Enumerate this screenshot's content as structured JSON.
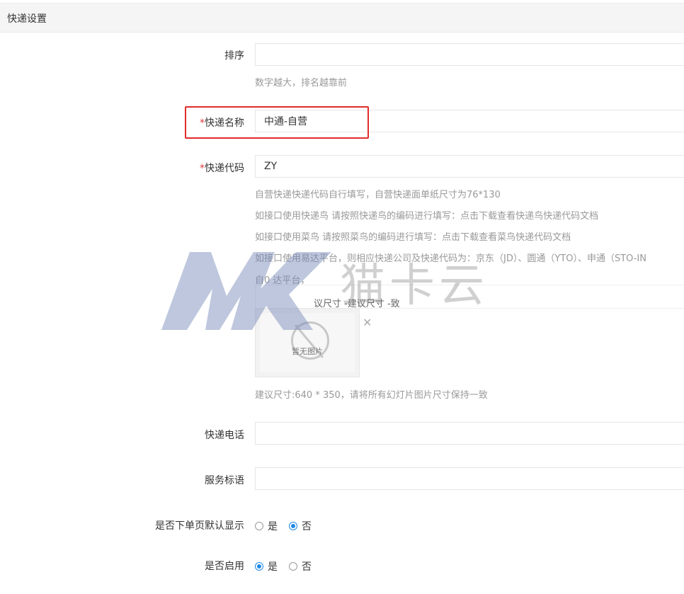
{
  "header": {
    "title": "快递设置"
  },
  "fields": {
    "sort": {
      "label": "排序",
      "value": "",
      "hint": "数字越大，排名越靠前"
    },
    "name": {
      "required_mark": "*",
      "label": "快递名称",
      "value": "中通-自营"
    },
    "code": {
      "required_mark": "*",
      "label": "快递代码",
      "value": "ZY",
      "hints": [
        "自营快递快递代码自行填写，自营快递面单纸尺寸为76*130",
        "如接口使用快递鸟 请按照快递鸟的编码进行填写：点击下载查看快递鸟快递代码文档",
        "如接口使用菜鸟 请按照菜鸟的编码进行填写：点击下载查看菜鸟快递代码文档",
        "如接口使用易达平台，则相应快递公司及快递代码为：京东（JD）、圆通（YTO）、申通（STO-IN",
        "自0 达平台，"
      ]
    },
    "image": {
      "partial_label": "议尺寸 -建议尺寸 -致",
      "placeholder_text": "暂无图片",
      "hint": "建议尺寸:640 * 350，请将所有幻灯片图片尺寸保持一致"
    },
    "phone": {
      "label": "快递电话",
      "value": ""
    },
    "slogan": {
      "label": "服务标语",
      "value": ""
    },
    "default_show": {
      "label": "是否下单页默认显示",
      "options": [
        "是",
        "否"
      ],
      "selected": "否"
    },
    "enabled": {
      "label": "是否启用",
      "options": [
        "是",
        "否"
      ],
      "selected": "是"
    }
  },
  "watermark": {
    "text": "猫卡云"
  },
  "colors": {
    "accent": "#1e88e5",
    "highlight": "#e02b2b",
    "required": "#e4393c"
  }
}
